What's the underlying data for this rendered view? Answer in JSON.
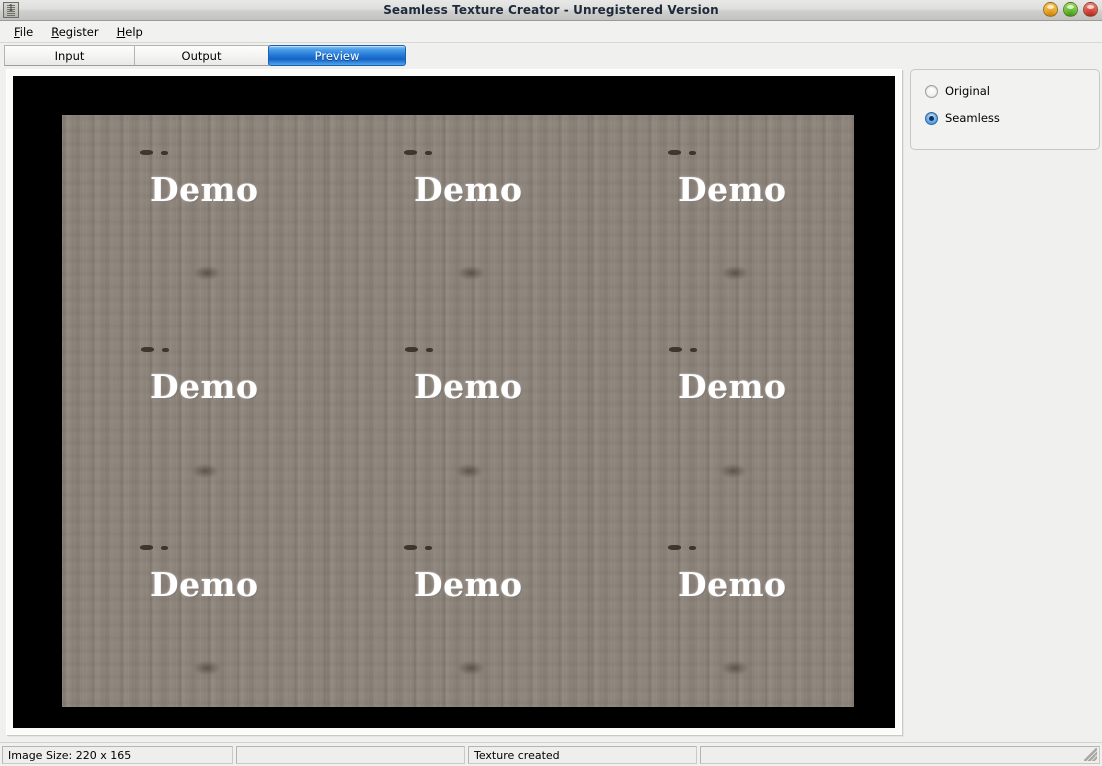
{
  "window": {
    "title": "Seamless Texture Creator - Unregistered Version",
    "icon": "app-icon",
    "controls": [
      {
        "name": "minimize",
        "color": "#e8a228"
      },
      {
        "name": "maximize",
        "color": "#63b832"
      },
      {
        "name": "close",
        "color": "#d3453a"
      }
    ]
  },
  "menubar": {
    "items": [
      {
        "label": "File",
        "mnemonic": "F",
        "rest": "ile"
      },
      {
        "label": "Register",
        "mnemonic": "R",
        "rest": "egister"
      },
      {
        "label": "Help",
        "mnemonic": "H",
        "rest": "elp"
      }
    ]
  },
  "tabs": {
    "items": [
      {
        "label": "Input",
        "active": false
      },
      {
        "label": "Output",
        "active": false
      },
      {
        "label": "Preview",
        "active": true
      }
    ],
    "active_index": 2,
    "active_color": "#1f75d4"
  },
  "preview": {
    "background_color": "#000000",
    "watermark_text": "Demo",
    "tile_count_horizontal": 3,
    "tile_count_vertical": 3,
    "texture_description": "weathered grey-brown wood planks, seamless mirrored tile"
  },
  "options": {
    "radios": [
      {
        "label": "Original",
        "selected": false
      },
      {
        "label": "Seamless",
        "selected": true
      }
    ]
  },
  "statusbar": {
    "panels": [
      {
        "text": "Image Size: 220 x 165"
      },
      {
        "text": ""
      },
      {
        "text": "Texture created"
      },
      {
        "text": ""
      }
    ],
    "resize_grip": true
  }
}
